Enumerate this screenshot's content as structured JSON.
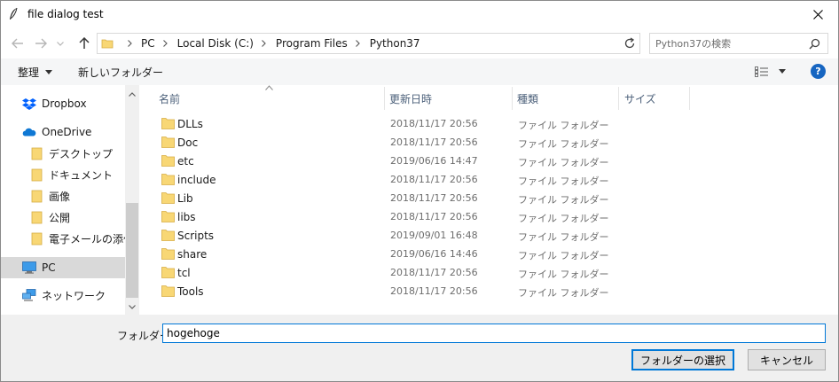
{
  "window": {
    "title": "file dialog test"
  },
  "address": {
    "crumbs": [
      "PC",
      "Local Disk (C:)",
      "Program Files",
      "Python37"
    ],
    "search_placeholder": "Python37の検索"
  },
  "toolbar": {
    "organize_label": "整理",
    "new_folder_label": "新しいフォルダー",
    "help_label": "?"
  },
  "nav_pane": {
    "items": [
      {
        "label": "Dropbox",
        "icon": "dropbox-icon"
      },
      {
        "label": "OneDrive",
        "icon": "onedrive-icon"
      },
      {
        "label": "デスクトップ",
        "icon": "folder-icon"
      },
      {
        "label": "ドキュメント",
        "icon": "folder-icon"
      },
      {
        "label": "画像",
        "icon": "folder-icon"
      },
      {
        "label": "公開",
        "icon": "folder-icon"
      },
      {
        "label": "電子メールの添付フ",
        "icon": "folder-icon"
      },
      {
        "label": "PC",
        "icon": "pc-icon",
        "selected": true
      },
      {
        "label": "ネットワーク",
        "icon": "network-icon"
      }
    ]
  },
  "file_list": {
    "columns": {
      "name": "名前",
      "date": "更新日時",
      "type": "種類",
      "size": "サイズ"
    },
    "rows": [
      {
        "name": "DLLs",
        "date": "2018/11/17 20:56",
        "type": "ファイル フォルダー"
      },
      {
        "name": "Doc",
        "date": "2018/11/17 20:56",
        "type": "ファイル フォルダー"
      },
      {
        "name": "etc",
        "date": "2019/06/16 14:47",
        "type": "ファイル フォルダー"
      },
      {
        "name": "include",
        "date": "2018/11/17 20:56",
        "type": "ファイル フォルダー"
      },
      {
        "name": "Lib",
        "date": "2018/11/17 20:56",
        "type": "ファイル フォルダー"
      },
      {
        "name": "libs",
        "date": "2018/11/17 20:56",
        "type": "ファイル フォルダー"
      },
      {
        "name": "Scripts",
        "date": "2019/09/01 16:48",
        "type": "ファイル フォルダー"
      },
      {
        "name": "share",
        "date": "2019/06/16 14:46",
        "type": "ファイル フォルダー"
      },
      {
        "name": "tcl",
        "date": "2018/11/17 20:56",
        "type": "ファイル フォルダー"
      },
      {
        "name": "Tools",
        "date": "2018/11/17 20:56",
        "type": "ファイル フォルダー"
      }
    ]
  },
  "footer": {
    "folder_label": "フォルダー:",
    "folder_value": "hogehoge",
    "select_button": "フォルダーの選択",
    "cancel_button": "キャンセル"
  },
  "colors": {
    "accent": "#0078d7",
    "folder": "#f8d775",
    "help": "#1665c1"
  }
}
